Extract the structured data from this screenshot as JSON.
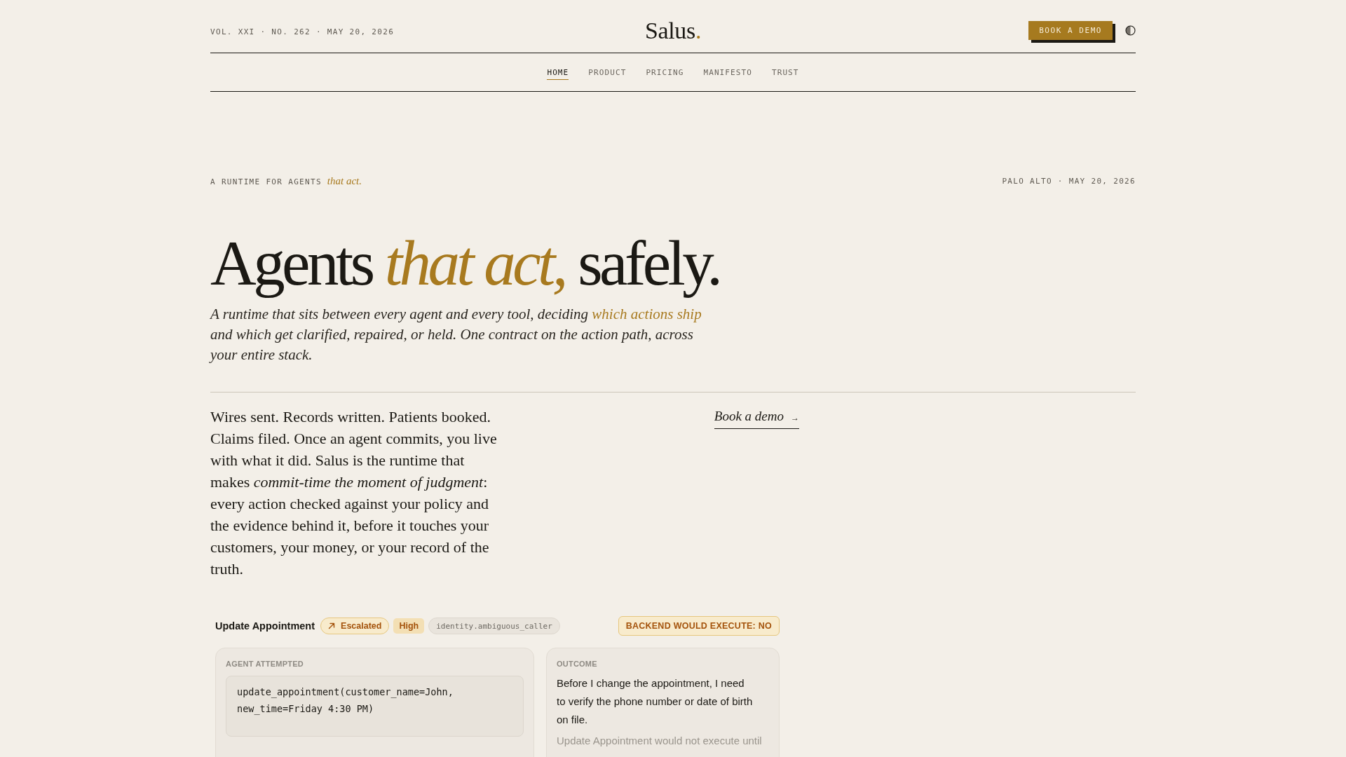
{
  "masthead": {
    "issue_line": "VOL. XXI · NO. 262 · MAY 20, 2026",
    "logo": "Salus",
    "logo_mark": ".",
    "cta": "BOOK A DEMO"
  },
  "nav": [
    {
      "label": "HOME",
      "selected": true
    },
    {
      "label": "PRODUCT",
      "selected": false
    },
    {
      "label": "PRICING",
      "selected": false
    },
    {
      "label": "MANIFESTO",
      "selected": false
    },
    {
      "label": "TRUST",
      "selected": false
    }
  ],
  "hero": {
    "eyebrow": "A RUNTIME FOR AGENTS",
    "eyebrow_accent": "that act.",
    "dateline": "PALO ALTO · MAY 20, 2026",
    "headline": "Agents *that act,* safely.",
    "subtitle": "A runtime that sits between every agent and every tool, deciding *which actions ship* and which get clarified, repaired, or held. One contract on the action path, across your entire stack."
  },
  "intro": {
    "body": "Wires sent. Records written. Patients booked. Claims filed. Once an agent commits, you live with what it did. Salus is the runtime that makes *commit-time the moment of judgment*: every action checked against your policy and the evidence behind it, before it touches your customers, your money, or your record of the truth.",
    "link": {
      "label": "Book a demo",
      "arrow": "→"
    }
  },
  "action_review": {
    "title": "Update Appointment",
    "tags": [
      {
        "kind": "status",
        "label": "Escalated"
      },
      {
        "kind": "severity",
        "label": "High"
      },
      {
        "kind": "code",
        "label": "identity.ambiguous_caller"
      }
    ],
    "verdict": "BACKEND WOULD EXECUTE: NO",
    "attempted": {
      "label": "AGENT ATTEMPTED",
      "code": "update_appointment(customer_name=John, new_time=Friday 4:30 PM)"
    },
    "outcome": {
      "label": "OUTCOME",
      "message": "Before I change the appointment, I need to verify the phone number or date of birth on file.",
      "note": "Update Appointment would not execute until"
    }
  }
}
